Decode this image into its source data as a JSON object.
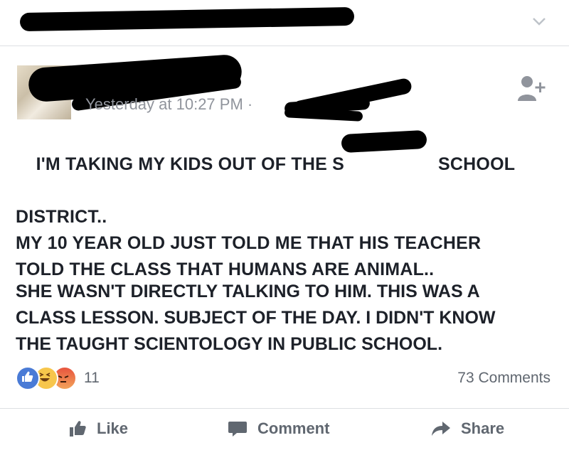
{
  "post": {
    "timestamp": "Yesterday at 10:27 PM ·",
    "body": {
      "line1": "I'M TAKING MY KIDS OUT OF THE S",
      "line1_end": "SCHOOL",
      "line2": "DISTRICT..",
      "line3": "MY 10 YEAR OLD JUST TOLD ME THAT HIS TEACHER",
      "line4": "TOLD THE CLASS THAT HUMANS ARE ANIMAL..",
      "para2_line1": "SHE WASN'T DIRECTLY TALKING TO HIM. THIS WAS A",
      "para2_line2": "CLASS LESSON. SUBJECT OF THE DAY. I DIDN'T KNOW",
      "para2_line3": "THE TAUGHT SCIENTOLOGY IN PUBLIC SCHOOL."
    },
    "reactions": {
      "count": "11",
      "types": [
        "like-reaction-icon",
        "haha-reaction-icon",
        "angry-reaction-icon"
      ]
    },
    "comments_count": "73 Comments"
  },
  "actions": {
    "like": "Like",
    "comment": "Comment",
    "share": "Share"
  },
  "colors": {
    "meta_text": "#90949c",
    "action_text": "#606770",
    "like_blue": "#4a7bd6",
    "divider": "#dddfe2"
  }
}
